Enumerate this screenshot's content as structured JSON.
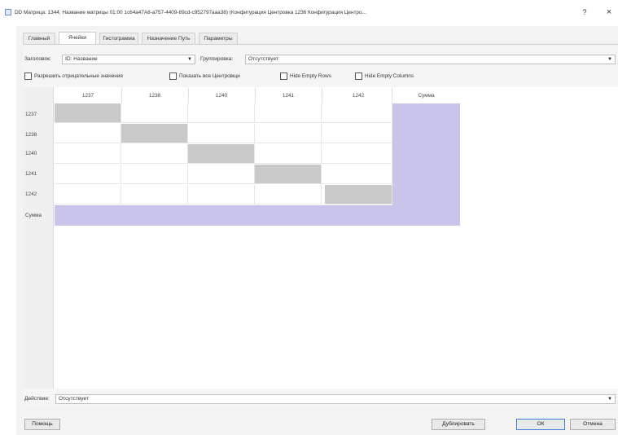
{
  "window": {
    "title": "DD Матрица: 1344; Название матрицы 01:00 1c64a47A8-a757-4409-89cd-c952797aaa38) (Конфигурация Центровка 1236 Конфигурация Центро...",
    "help_label": "?",
    "close_label": "×"
  },
  "tabs": [
    {
      "label": "Главный",
      "active": false
    },
    {
      "label": "Ячейки",
      "active": true
    },
    {
      "label": "Гистограмма",
      "active": false
    },
    {
      "label": "Назначение Путь",
      "active": false
    },
    {
      "label": "Параметры",
      "active": false
    }
  ],
  "controls": {
    "header_label": "Заголовок:",
    "header_value": "ID: Название",
    "grouping_label": "Группировка:",
    "grouping_value": "Отсутствует",
    "caret": "▼"
  },
  "checkboxes": [
    {
      "label": "Разрешить отрицательные значения",
      "checked": false
    },
    {
      "label": "Показать все Центровщи",
      "checked": false
    },
    {
      "label": "Hide Empty Rows",
      "checked": false
    },
    {
      "label": "Hide Empty Columns",
      "checked": false
    }
  ],
  "matrix": {
    "columns": [
      "1237",
      "1238",
      "1240",
      "1241",
      "1242"
    ],
    "rows": [
      "1237",
      "1238",
      "1240",
      "1241",
      "1242"
    ],
    "sum_label": "Сумма"
  },
  "action": {
    "label": "Действие:",
    "value": "Отсутствует"
  },
  "buttons": {
    "help": "Помощь",
    "duplicate": "Дублировать",
    "ok": "ОК",
    "cancel": "Отмена"
  },
  "colors": {
    "sum_fill": "#c8c4ea",
    "diagonal_fill": "#c9c9c9",
    "ok_border": "#3b7bd6"
  }
}
